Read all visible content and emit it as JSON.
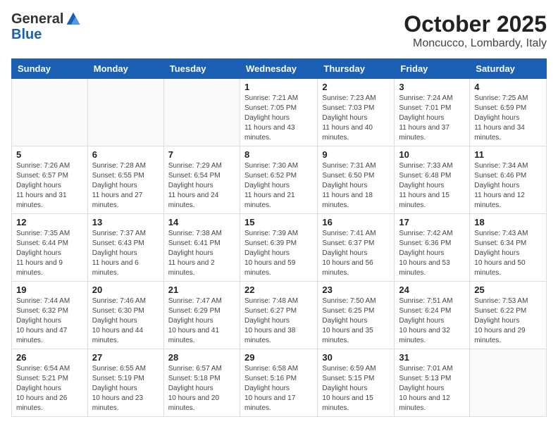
{
  "logo": {
    "general": "General",
    "blue": "Blue"
  },
  "header": {
    "month": "October 2025",
    "location": "Moncucco, Lombardy, Italy"
  },
  "weekdays": [
    "Sunday",
    "Monday",
    "Tuesday",
    "Wednesday",
    "Thursday",
    "Friday",
    "Saturday"
  ],
  "weeks": [
    [
      {
        "day": "",
        "sunrise": "",
        "sunset": "",
        "daylight": ""
      },
      {
        "day": "",
        "sunrise": "",
        "sunset": "",
        "daylight": ""
      },
      {
        "day": "",
        "sunrise": "",
        "sunset": "",
        "daylight": ""
      },
      {
        "day": "1",
        "sunrise": "7:21 AM",
        "sunset": "7:05 PM",
        "daylight": "11 hours and 43 minutes."
      },
      {
        "day": "2",
        "sunrise": "7:23 AM",
        "sunset": "7:03 PM",
        "daylight": "11 hours and 40 minutes."
      },
      {
        "day": "3",
        "sunrise": "7:24 AM",
        "sunset": "7:01 PM",
        "daylight": "11 hours and 37 minutes."
      },
      {
        "day": "4",
        "sunrise": "7:25 AM",
        "sunset": "6:59 PM",
        "daylight": "11 hours and 34 minutes."
      }
    ],
    [
      {
        "day": "5",
        "sunrise": "7:26 AM",
        "sunset": "6:57 PM",
        "daylight": "11 hours and 31 minutes."
      },
      {
        "day": "6",
        "sunrise": "7:28 AM",
        "sunset": "6:55 PM",
        "daylight": "11 hours and 27 minutes."
      },
      {
        "day": "7",
        "sunrise": "7:29 AM",
        "sunset": "6:54 PM",
        "daylight": "11 hours and 24 minutes."
      },
      {
        "day": "8",
        "sunrise": "7:30 AM",
        "sunset": "6:52 PM",
        "daylight": "11 hours and 21 minutes."
      },
      {
        "day": "9",
        "sunrise": "7:31 AM",
        "sunset": "6:50 PM",
        "daylight": "11 hours and 18 minutes."
      },
      {
        "day": "10",
        "sunrise": "7:33 AM",
        "sunset": "6:48 PM",
        "daylight": "11 hours and 15 minutes."
      },
      {
        "day": "11",
        "sunrise": "7:34 AM",
        "sunset": "6:46 PM",
        "daylight": "11 hours and 12 minutes."
      }
    ],
    [
      {
        "day": "12",
        "sunrise": "7:35 AM",
        "sunset": "6:44 PM",
        "daylight": "11 hours and 9 minutes."
      },
      {
        "day": "13",
        "sunrise": "7:37 AM",
        "sunset": "6:43 PM",
        "daylight": "11 hours and 6 minutes."
      },
      {
        "day": "14",
        "sunrise": "7:38 AM",
        "sunset": "6:41 PM",
        "daylight": "11 hours and 2 minutes."
      },
      {
        "day": "15",
        "sunrise": "7:39 AM",
        "sunset": "6:39 PM",
        "daylight": "10 hours and 59 minutes."
      },
      {
        "day": "16",
        "sunrise": "7:41 AM",
        "sunset": "6:37 PM",
        "daylight": "10 hours and 56 minutes."
      },
      {
        "day": "17",
        "sunrise": "7:42 AM",
        "sunset": "6:36 PM",
        "daylight": "10 hours and 53 minutes."
      },
      {
        "day": "18",
        "sunrise": "7:43 AM",
        "sunset": "6:34 PM",
        "daylight": "10 hours and 50 minutes."
      }
    ],
    [
      {
        "day": "19",
        "sunrise": "7:44 AM",
        "sunset": "6:32 PM",
        "daylight": "10 hours and 47 minutes."
      },
      {
        "day": "20",
        "sunrise": "7:46 AM",
        "sunset": "6:30 PM",
        "daylight": "10 hours and 44 minutes."
      },
      {
        "day": "21",
        "sunrise": "7:47 AM",
        "sunset": "6:29 PM",
        "daylight": "10 hours and 41 minutes."
      },
      {
        "day": "22",
        "sunrise": "7:48 AM",
        "sunset": "6:27 PM",
        "daylight": "10 hours and 38 minutes."
      },
      {
        "day": "23",
        "sunrise": "7:50 AM",
        "sunset": "6:25 PM",
        "daylight": "10 hours and 35 minutes."
      },
      {
        "day": "24",
        "sunrise": "7:51 AM",
        "sunset": "6:24 PM",
        "daylight": "10 hours and 32 minutes."
      },
      {
        "day": "25",
        "sunrise": "7:53 AM",
        "sunset": "6:22 PM",
        "daylight": "10 hours and 29 minutes."
      }
    ],
    [
      {
        "day": "26",
        "sunrise": "6:54 AM",
        "sunset": "5:21 PM",
        "daylight": "10 hours and 26 minutes."
      },
      {
        "day": "27",
        "sunrise": "6:55 AM",
        "sunset": "5:19 PM",
        "daylight": "10 hours and 23 minutes."
      },
      {
        "day": "28",
        "sunrise": "6:57 AM",
        "sunset": "5:18 PM",
        "daylight": "10 hours and 20 minutes."
      },
      {
        "day": "29",
        "sunrise": "6:58 AM",
        "sunset": "5:16 PM",
        "daylight": "10 hours and 17 minutes."
      },
      {
        "day": "30",
        "sunrise": "6:59 AM",
        "sunset": "5:15 PM",
        "daylight": "10 hours and 15 minutes."
      },
      {
        "day": "31",
        "sunrise": "7:01 AM",
        "sunset": "5:13 PM",
        "daylight": "10 hours and 12 minutes."
      },
      {
        "day": "",
        "sunrise": "",
        "sunset": "",
        "daylight": ""
      }
    ]
  ]
}
